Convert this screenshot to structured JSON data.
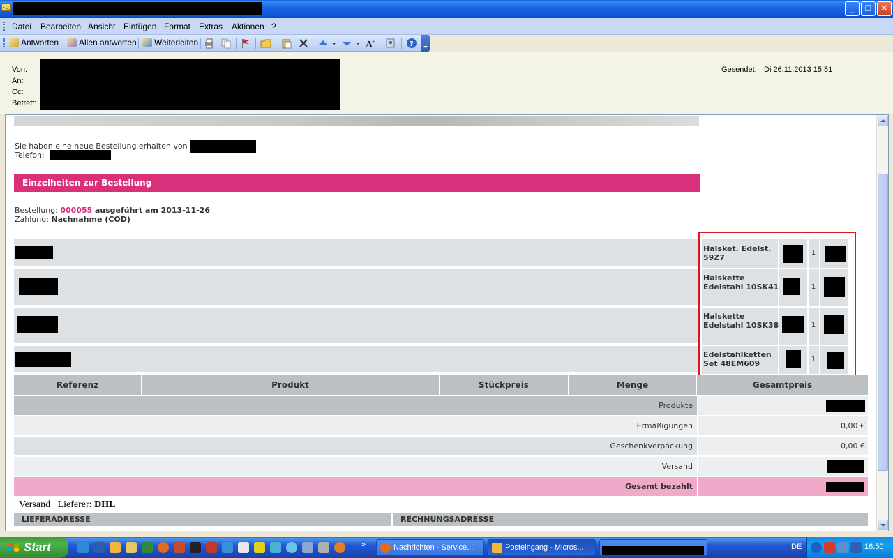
{
  "window": {
    "minimize_glyph": "_",
    "maximize_glyph": "❐",
    "close_glyph": "✕"
  },
  "menu": {
    "items": [
      "Datei",
      "Bearbeiten",
      "Ansicht",
      "Einfügen",
      "Format",
      "Extras",
      "Aktionen",
      "?"
    ]
  },
  "toolbar": {
    "reply": "Antworten",
    "reply_all": "Allen antworten",
    "forward": "Weiterleiten"
  },
  "header": {
    "from_label": "Von:",
    "to_label": "An:",
    "cc_label": "Cc:",
    "subject_label": "Betreff:",
    "sent_label": "Gesendet:",
    "sent_value": "Di 26.11.2013 15:51"
  },
  "message": {
    "intro_line": "Sie haben eine neue Bestellung erhalten von",
    "phone_label": "Telefon:",
    "section_title": "Einzelheiten zur Bestellung",
    "order_label": "Bestellung:",
    "order_number": "000055",
    "order_executed": "ausgeführt am 2013-11-26",
    "payment_label": "Zahlung:",
    "payment_value": "Nachnahme (COD)",
    "products": [
      {
        "name": "Halsket. Edelst. 59Z7",
        "qty": "1"
      },
      {
        "name": "Halskette Edelstahl 10SK41",
        "qty": "1"
      },
      {
        "name": "Halskette Edelstahl 10SK38",
        "qty": "1"
      },
      {
        "name": "Edelstahlketten Set 48EM609",
        "qty": "1"
      }
    ],
    "columns": [
      "Referenz",
      "Produkt",
      "Stückpreis",
      "Menge",
      "Gesamtpreis"
    ],
    "totals": [
      {
        "label": "Produkte",
        "value": ""
      },
      {
        "label": "Ermäßigungen",
        "value": "0,00 €"
      },
      {
        "label": "Geschenkverpackung",
        "value": "0,00 €"
      },
      {
        "label": "Versand",
        "value": ""
      },
      {
        "label": "Gesamt bezahlt",
        "value": ""
      }
    ],
    "shipping_label": "Versand",
    "carrier_label": "Lieferer:",
    "carrier_value": "DHL",
    "delivery_address": "LIEFERADRESSE",
    "billing_address": "RECHNUNGSADRESSE"
  },
  "taskbar": {
    "start": "Start",
    "tasks": [
      "Nachrichten - Service...",
      "Posteingang - Micros..."
    ],
    "language": "DE",
    "clock": "16:50"
  },
  "colors": {
    "accent_pink": "#d8307b",
    "total_pink": "#f0a9c9",
    "row_gray": "#dde1e3",
    "header_gray": "#bcc0c3",
    "highlight_red": "#e0141e"
  }
}
